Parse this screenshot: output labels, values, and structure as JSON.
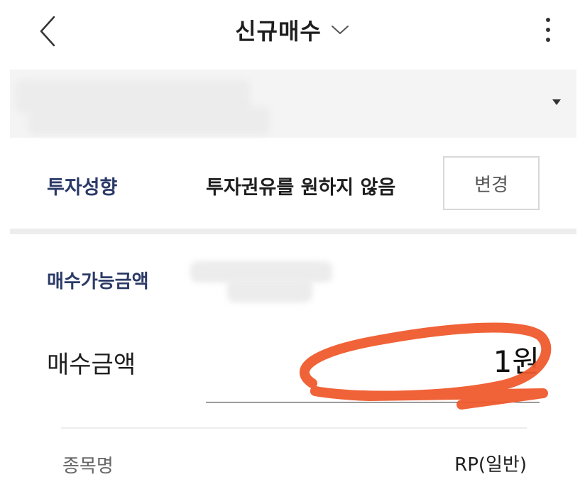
{
  "header": {
    "title": "신규매수",
    "back_icon": "chevron-left-icon",
    "dropdown_icon": "chevron-down-icon",
    "more_icon": "more-vertical-icon"
  },
  "account_selector": {
    "caret_icon": "caret-down-icon"
  },
  "investment_tendency": {
    "label": "투자성향",
    "value": "투자권유를 원하지 않음",
    "change_label": "변경"
  },
  "available_amount": {
    "label": "매수가능금액"
  },
  "purchase_amount": {
    "label": "매수금액",
    "value": "1원",
    "annotation_color": "#ef5a2c"
  },
  "item_name": {
    "label": "종목명",
    "value": "RP(일반)"
  },
  "colors": {
    "label_accent": "#2b3a67",
    "section_bg": "#f4f4f5"
  }
}
